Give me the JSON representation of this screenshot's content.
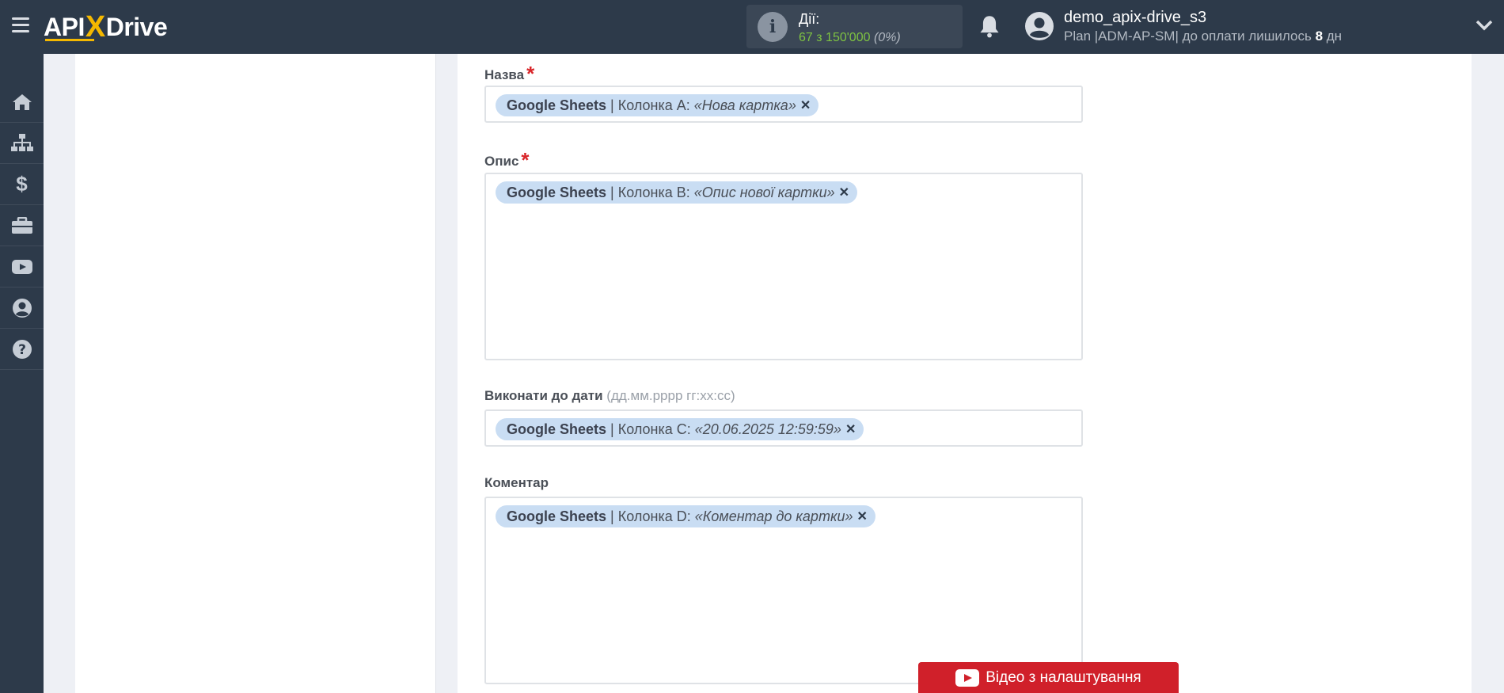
{
  "header": {
    "logo": {
      "left": "API",
      "x": "X",
      "right": "Drive"
    },
    "actions": {
      "label": "Дії:",
      "used": "67",
      "of": "з",
      "total": "150'000",
      "percent": "(0%)"
    },
    "user": {
      "name": "demo_apix-drive_s3",
      "plan_prefix": "Plan |ADM-AP-SM| до оплати лишилось",
      "days": "8",
      "days_unit": "дн"
    }
  },
  "sidebar": {
    "items": [
      {
        "icon": "home-icon"
      },
      {
        "icon": "sitemap-icon"
      },
      {
        "icon": "dollar-icon"
      },
      {
        "icon": "briefcase-icon"
      },
      {
        "icon": "youtube-icon"
      },
      {
        "icon": "user-icon"
      },
      {
        "icon": "question-icon"
      }
    ]
  },
  "form": {
    "fields": [
      {
        "label": "Назва",
        "required": "*",
        "chip": {
          "source": "Google Sheets",
          "sep": "|",
          "column": "Колонка A:",
          "value": "«Нова картка»",
          "remove": "✕"
        }
      },
      {
        "label": "Опис",
        "required": "*",
        "chip": {
          "source": "Google Sheets",
          "sep": "|",
          "column": "Колонка B:",
          "value": "«Опис нової картки»",
          "remove": "✕"
        }
      },
      {
        "label": "Виконати до дати",
        "hint": "(дд.мм.рррр гг:хх:сс)",
        "chip": {
          "source": "Google Sheets",
          "sep": "|",
          "column": "Колонка C:",
          "value": "«20.06.2025 12:59:59»",
          "remove": "✕"
        }
      },
      {
        "label": "Коментар",
        "chip": {
          "source": "Google Sheets",
          "sep": "|",
          "column": "Колонка D:",
          "value": "«Коментар до картки»",
          "remove": "✕"
        }
      }
    ]
  },
  "video_button": {
    "label": "Відео з налаштування"
  },
  "colors": {
    "topbar": "#2d3a4a",
    "chip": "#c9ddf3",
    "required": "#d9262a",
    "video": "#d0202a",
    "accent": "#f5b800"
  }
}
